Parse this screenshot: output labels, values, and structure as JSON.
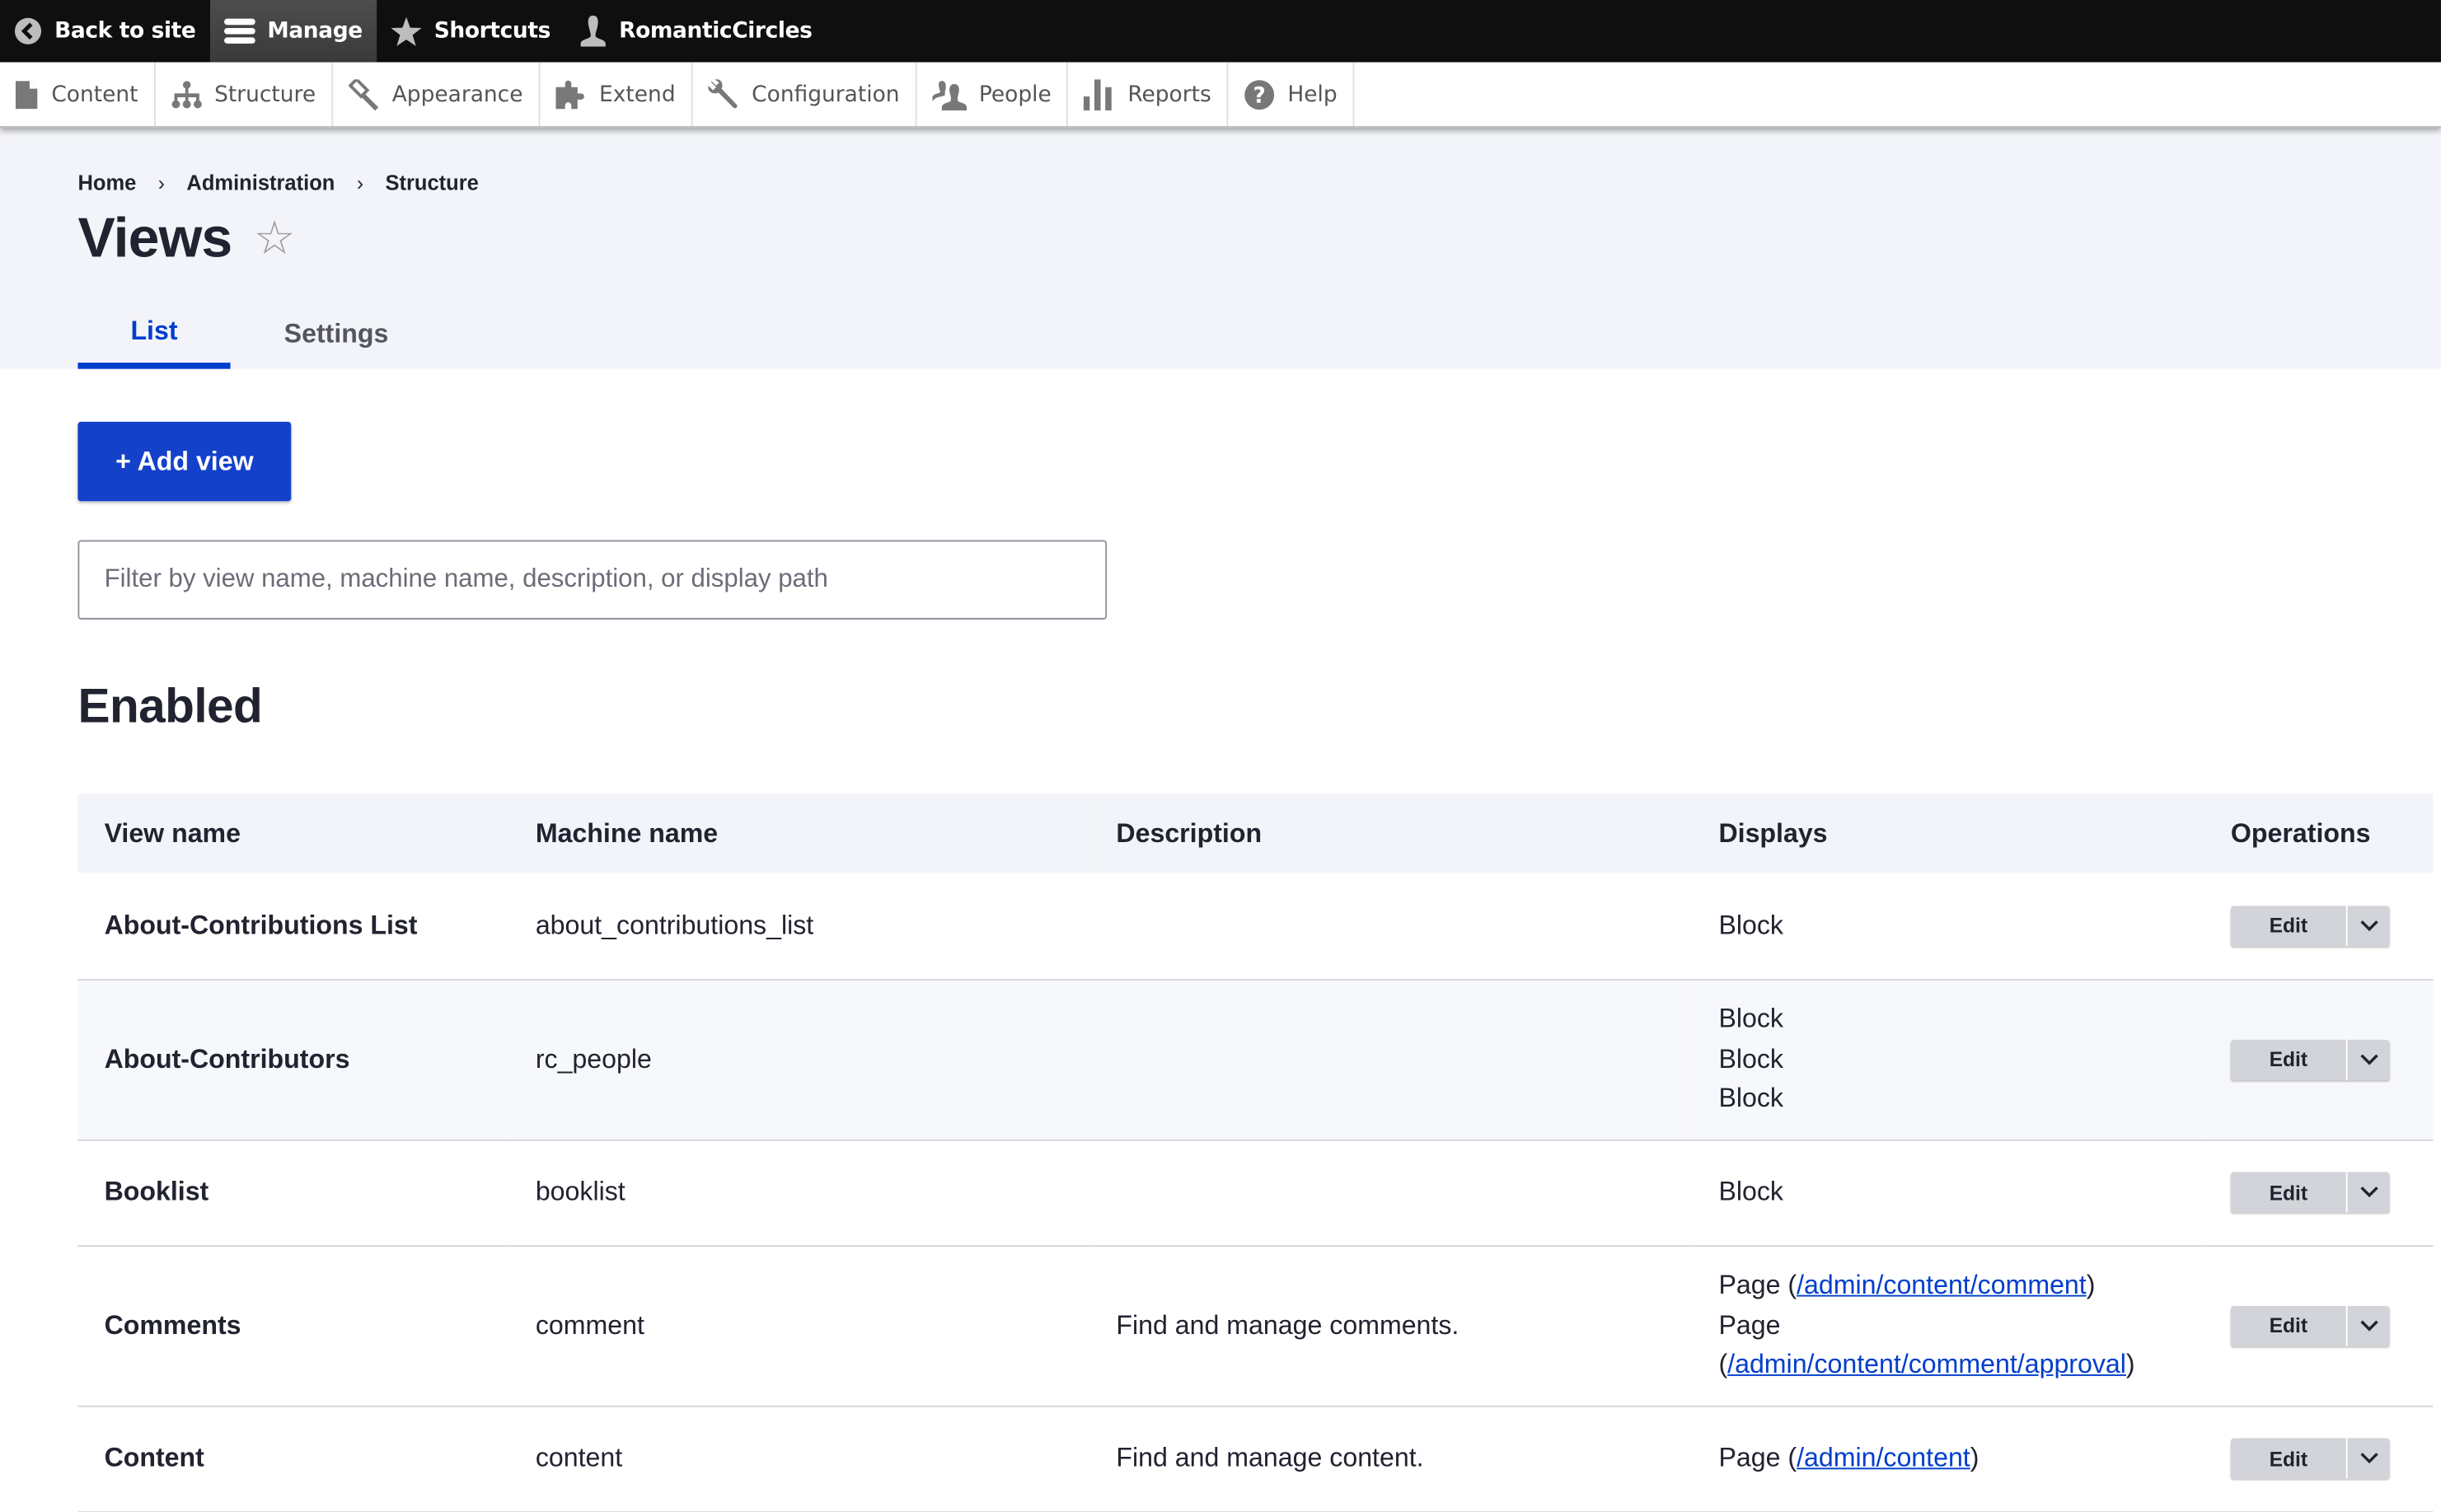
{
  "toolbar": {
    "items": [
      {
        "label": "Back to site",
        "icon": "back-circle-icon"
      },
      {
        "label": "Manage",
        "icon": "hamburger-menu-icon",
        "active": true
      },
      {
        "label": "Shortcuts",
        "icon": "star-icon"
      },
      {
        "label": "RomanticCircles",
        "icon": "user-icon"
      }
    ]
  },
  "tray": {
    "items": [
      {
        "label": "Content",
        "icon": "file-icon"
      },
      {
        "label": "Structure",
        "icon": "sitemap-icon"
      },
      {
        "label": "Appearance",
        "icon": "paintbrush-icon"
      },
      {
        "label": "Extend",
        "icon": "puzzle-icon"
      },
      {
        "label": "Configuration",
        "icon": "wrench-icon"
      },
      {
        "label": "People",
        "icon": "people-icon"
      },
      {
        "label": "Reports",
        "icon": "bar-chart-icon"
      },
      {
        "label": "Help",
        "icon": "help-circle-icon"
      }
    ]
  },
  "breadcrumb": [
    "Home",
    "Administration",
    "Structure"
  ],
  "breadcrumb_separator": "›",
  "page": {
    "title": "Views",
    "star": "☆",
    "tabs": [
      {
        "label": "List",
        "active": true
      },
      {
        "label": "Settings",
        "active": false
      }
    ],
    "add_button": "+ Add view",
    "filter_placeholder": "Filter by view name, machine name, description, or display path",
    "filter_value": "",
    "section_title": "Enabled"
  },
  "table": {
    "headers": [
      "View name",
      "Machine name",
      "Description",
      "Displays",
      "Operations"
    ],
    "edit_label": "Edit",
    "rows": [
      {
        "name": "About-Contributions List",
        "machine": "about_contributions_list",
        "description": "",
        "displays": [
          {
            "type": "Block"
          }
        ]
      },
      {
        "name": "About-Contributors",
        "machine": "rc_people",
        "description": "",
        "displays": [
          {
            "type": "Block"
          },
          {
            "type": "Block"
          },
          {
            "type": "Block"
          }
        ]
      },
      {
        "name": "Booklist",
        "machine": "booklist",
        "description": "",
        "displays": [
          {
            "type": "Block"
          }
        ]
      },
      {
        "name": "Comments",
        "machine": "comment",
        "description": "Find and manage comments.",
        "displays": [
          {
            "type": "Page",
            "path": "/admin/content/comment"
          },
          {
            "type": "Page",
            "path": "/admin/content/comment/approval"
          }
        ]
      },
      {
        "name": "Content",
        "machine": "content",
        "description": "Find and manage content.",
        "displays": [
          {
            "type": "Page",
            "path": "/admin/content"
          }
        ]
      }
    ]
  },
  "colors": {
    "accent": "#003ecc",
    "toolbar_bg": "#0f0f0f",
    "header_bg": "#f3f4f9"
  }
}
